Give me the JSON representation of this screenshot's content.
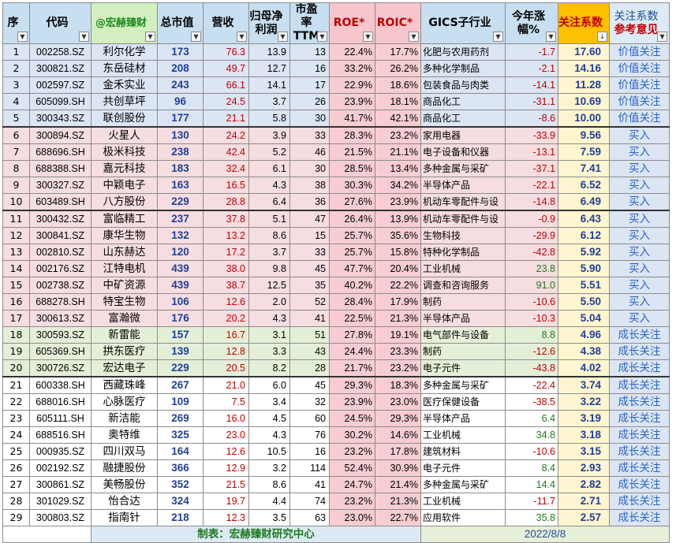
{
  "headers": {
    "idx": "序",
    "code": "代码",
    "brand": "@宏赫臻财",
    "cap": "总市值",
    "rev": "营收",
    "profit": "归母净利润",
    "pe": "市盈率TTM",
    "roe": "ROE*",
    "roic": "ROIC*",
    "industry": "GICS子行业",
    "ytd": "今年涨幅%",
    "score": "关注系数",
    "follow_top": "关注系数",
    "follow_bot": "参考意见",
    "filter_glyph": "▼",
    "sort_glyph": "↓"
  },
  "colors": {
    "group_blue": "#dbe5f3",
    "group_pink": "#f6dde0",
    "group_green": "#e4efd8",
    "accent_red": "#c00000",
    "accent_blue": "#1f3f9a"
  },
  "rows": [
    {
      "idx": "1",
      "code": "002258.SZ",
      "name": "利尔化学",
      "cap": "173",
      "rev": "76.3",
      "profit": "13.9",
      "pe": "13",
      "roe": "22.4%",
      "roic": "17.7%",
      "industry": "化肥与农用药剂",
      "ytd": "-1.7",
      "score": "17.60",
      "action": "价值关注"
    },
    {
      "idx": "2",
      "code": "300821.SZ",
      "name": "东岳硅材",
      "cap": "208",
      "rev": "49.7",
      "profit": "12.7",
      "pe": "16",
      "roe": "33.2%",
      "roic": "26.2%",
      "industry": "多种化学制品",
      "ytd": "-2.1",
      "score": "14.16",
      "action": "价值关注"
    },
    {
      "idx": "3",
      "code": "002597.SZ",
      "name": "金禾实业",
      "cap": "243",
      "rev": "66.1",
      "profit": "14.1",
      "pe": "17",
      "roe": "22.9%",
      "roic": "18.6%",
      "industry": "包装食品与肉类",
      "ytd": "-14.1",
      "score": "11.28",
      "action": "价值关注"
    },
    {
      "idx": "4",
      "code": "605099.SH",
      "name": "共创草坪",
      "cap": "96",
      "rev": "24.5",
      "profit": "3.7",
      "pe": "26",
      "roe": "23.9%",
      "roic": "18.1%",
      "industry": "商品化工",
      "ytd": "-31.1",
      "score": "10.69",
      "action": "价值关注"
    },
    {
      "idx": "5",
      "code": "300343.SZ",
      "name": "联创股份",
      "cap": "177",
      "rev": "21.1",
      "profit": "5.8",
      "pe": "30",
      "roe": "41.7%",
      "roic": "42.1%",
      "industry": "商品化工",
      "ytd": "-8.6",
      "score": "10.00",
      "action": "价值关注"
    },
    {
      "idx": "6",
      "code": "300894.SZ",
      "name": "火星人",
      "cap": "130",
      "rev": "24.2",
      "profit": "3.9",
      "pe": "33",
      "roe": "28.3%",
      "roic": "23.2%",
      "industry": "家用电器",
      "ytd": "-33.9",
      "score": "9.56",
      "action": "买入"
    },
    {
      "idx": "7",
      "code": "688696.SH",
      "name": "极米科技",
      "cap": "238",
      "rev": "42.4",
      "profit": "5.2",
      "pe": "46",
      "roe": "21.5%",
      "roic": "21.1%",
      "industry": "电子设备和仪器",
      "ytd": "-13.1",
      "score": "7.59",
      "action": "买入"
    },
    {
      "idx": "8",
      "code": "688388.SH",
      "name": "嘉元科技",
      "cap": "183",
      "rev": "32.4",
      "profit": "6.1",
      "pe": "30",
      "roe": "28.5%",
      "roic": "13.4%",
      "industry": "多种金属与采矿",
      "ytd": "-37.1",
      "score": "7.41",
      "action": "买入"
    },
    {
      "idx": "9",
      "code": "300327.SZ",
      "name": "中颖电子",
      "cap": "163",
      "rev": "16.5",
      "profit": "4.3",
      "pe": "38",
      "roe": "30.3%",
      "roic": "34.2%",
      "industry": "半导体产品",
      "ytd": "-22.1",
      "score": "6.52",
      "action": "买入"
    },
    {
      "idx": "10",
      "code": "603489.SH",
      "name": "八方股份",
      "cap": "229",
      "rev": "28.8",
      "profit": "6.4",
      "pe": "36",
      "roe": "27.6%",
      "roic": "23.9%",
      "industry": "机动车零配件与设",
      "ytd": "-14.8",
      "score": "6.49",
      "action": "买入"
    },
    {
      "idx": "11",
      "code": "300432.SZ",
      "name": "富临精工",
      "cap": "237",
      "rev": "37.8",
      "profit": "5.1",
      "pe": "47",
      "roe": "26.4%",
      "roic": "13.9%",
      "industry": "机动车零配件与设",
      "ytd": "-0.9",
      "score": "6.43",
      "action": "买入"
    },
    {
      "idx": "12",
      "code": "300841.SZ",
      "name": "康华生物",
      "cap": "132",
      "rev": "13.2",
      "profit": "8.6",
      "pe": "15",
      "roe": "25.7%",
      "roic": "35.6%",
      "industry": "生物科技",
      "ytd": "-29.9",
      "score": "6.12",
      "action": "买入"
    },
    {
      "idx": "13",
      "code": "002810.SZ",
      "name": "山东赫达",
      "cap": "120",
      "rev": "17.2",
      "profit": "3.7",
      "pe": "33",
      "roe": "25.7%",
      "roic": "15.8%",
      "industry": "特种化学制品",
      "ytd": "-42.8",
      "score": "5.92",
      "action": "买入"
    },
    {
      "idx": "14",
      "code": "002176.SZ",
      "name": "江特电机",
      "cap": "439",
      "rev": "38.0",
      "profit": "9.8",
      "pe": "45",
      "roe": "47.7%",
      "roic": "20.4%",
      "industry": "工业机械",
      "ytd": "23.8",
      "score": "5.90",
      "action": "买入"
    },
    {
      "idx": "15",
      "code": "002738.SZ",
      "name": "中矿资源",
      "cap": "439",
      "rev": "38.7",
      "profit": "12.5",
      "pe": "35",
      "roe": "40.2%",
      "roic": "22.2%",
      "industry": "调查和咨询服务",
      "ytd": "91.0",
      "score": "5.51",
      "action": "买入"
    },
    {
      "idx": "16",
      "code": "688278.SH",
      "name": "特宝生物",
      "cap": "106",
      "rev": "12.6",
      "profit": "2.0",
      "pe": "52",
      "roe": "28.4%",
      "roic": "17.9%",
      "industry": "制药",
      "ytd": "-10.6",
      "score": "5.50",
      "action": "买入"
    },
    {
      "idx": "17",
      "code": "300613.SZ",
      "name": "富瀚微",
      "cap": "176",
      "rev": "20.2",
      "profit": "4.3",
      "pe": "41",
      "roe": "22.5%",
      "roic": "21.3%",
      "industry": "半导体产品",
      "ytd": "-10.3",
      "score": "5.04",
      "action": "买入"
    },
    {
      "idx": "18",
      "code": "300593.SZ",
      "name": "新雷能",
      "cap": "157",
      "rev": "16.7",
      "profit": "3.1",
      "pe": "51",
      "roe": "27.8%",
      "roic": "19.1%",
      "industry": "电气部件与设备",
      "ytd": "8.8",
      "score": "4.96",
      "action": "成长关注"
    },
    {
      "idx": "19",
      "code": "605369.SH",
      "name": "拱东医疗",
      "cap": "139",
      "rev": "12.8",
      "profit": "3.3",
      "pe": "43",
      "roe": "24.4%",
      "roic": "23.3%",
      "industry": "制药",
      "ytd": "-12.6",
      "score": "4.38",
      "action": "成长关注"
    },
    {
      "idx": "20",
      "code": "300726.SZ",
      "name": "宏达电子",
      "cap": "229",
      "rev": "20.5",
      "profit": "8.2",
      "pe": "28",
      "roe": "21.7%",
      "roic": "23.2%",
      "industry": "电子元件",
      "ytd": "-43.8",
      "score": "4.02",
      "action": "成长关注"
    },
    {
      "idx": "21",
      "code": "600338.SH",
      "name": "西藏珠峰",
      "cap": "267",
      "rev": "21.0",
      "profit": "6.0",
      "pe": "45",
      "roe": "29.3%",
      "roic": "18.3%",
      "industry": "多种金属与采矿",
      "ytd": "-22.4",
      "score": "3.74",
      "action": "成长关注"
    },
    {
      "idx": "22",
      "code": "688016.SH",
      "name": "心脉医疗",
      "cap": "109",
      "rev": "7.5",
      "profit": "3.4",
      "pe": "32",
      "roe": "23.9%",
      "roic": "23.0%",
      "industry": "医疗保健设备",
      "ytd": "-38.5",
      "score": "3.22",
      "action": "成长关注"
    },
    {
      "idx": "23",
      "code": "605111.SH",
      "name": "新洁能",
      "cap": "269",
      "rev": "16.0",
      "profit": "4.5",
      "pe": "60",
      "roe": "24.5%",
      "roic": "29.3%",
      "industry": "半导体产品",
      "ytd": "6.4",
      "score": "3.19",
      "action": "成长关注"
    },
    {
      "idx": "24",
      "code": "688516.SH",
      "name": "奥特维",
      "cap": "325",
      "rev": "23.0",
      "profit": "4.3",
      "pe": "76",
      "roe": "30.2%",
      "roic": "14.6%",
      "industry": "工业机械",
      "ytd": "34.8",
      "score": "3.18",
      "action": "成长关注"
    },
    {
      "idx": "25",
      "code": "000935.SZ",
      "name": "四川双马",
      "cap": "164",
      "rev": "12.6",
      "profit": "10.5",
      "pe": "16",
      "roe": "23.2%",
      "roic": "17.8%",
      "industry": "建筑材料",
      "ytd": "-10.6",
      "score": "3.15",
      "action": "成长关注"
    },
    {
      "idx": "26",
      "code": "002192.SZ",
      "name": "融捷股份",
      "cap": "366",
      "rev": "12.9",
      "profit": "3.2",
      "pe": "114",
      "roe": "52.4%",
      "roic": "30.9%",
      "industry": "电子元件",
      "ytd": "8.4",
      "score": "2.93",
      "action": "成长关注"
    },
    {
      "idx": "27",
      "code": "300861.SZ",
      "name": "美畅股份",
      "cap": "352",
      "rev": "21.5",
      "profit": "8.6",
      "pe": "41",
      "roe": "24.7%",
      "roic": "21.4%",
      "industry": "多种金属与采矿",
      "ytd": "14.4",
      "score": "2.82",
      "action": "成长关注"
    },
    {
      "idx": "28",
      "code": "301029.SZ",
      "name": "怡合达",
      "cap": "324",
      "rev": "19.7",
      "profit": "4.4",
      "pe": "74",
      "roe": "23.2%",
      "roic": "21.3%",
      "industry": "工业机械",
      "ytd": "-11.7",
      "score": "2.71",
      "action": "成长关注"
    },
    {
      "idx": "29",
      "code": "300803.SZ",
      "name": "指南针",
      "cap": "218",
      "rev": "12.3",
      "profit": "3.5",
      "pe": "63",
      "roe": "23.0%",
      "roic": "22.7%",
      "industry": "应用软件",
      "ytd": "35.8",
      "score": "2.57",
      "action": "成长关注"
    }
  ],
  "footer": {
    "credit": "制表：宏赫臻财研究中心",
    "date": "2022/8/8"
  }
}
